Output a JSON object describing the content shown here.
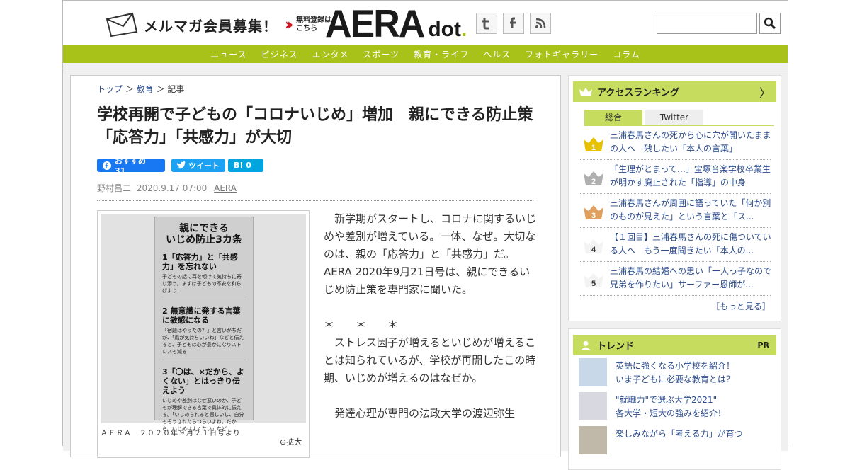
{
  "header": {
    "mailmag": "メルマガ会員募集！",
    "free_line1": "無料登録は",
    "free_line2": "こちら",
    "logo_main": "AERA",
    "logo_dot": "dot",
    "logo_period": ".",
    "social": [
      {
        "name": "twitter-icon",
        "glyph": "t"
      },
      {
        "name": "facebook-icon",
        "glyph": "f"
      },
      {
        "name": "rss-icon",
        "glyph": ")"
      }
    ],
    "search_placeholder": ""
  },
  "nav": [
    "ニュース",
    "ビジネス",
    "エンタメ",
    "スポーツ",
    "教育・ライフ",
    "ヘルス",
    "フォトギャラリー",
    "コラム"
  ],
  "breadcrumb": {
    "top": "トップ",
    "edu": "教育",
    "article": "記事"
  },
  "article": {
    "title": "学校再開で子どもの「コロナいじめ」増加　親にできる防止策「応答力」「共感力」が大切",
    "share_fb": "おすすめ 31",
    "share_tw": "ツイート",
    "share_hb": "B! 0",
    "author": "野村昌二",
    "date": "2020.9.17 07:00",
    "publication": "AERA",
    "image_caption": "ＡＥＲＡ　２０２０年９月２１日号より",
    "zoom": "拡大",
    "paragraphs": [
      "　新学期がスタートし、コロナに関するいじめや差別が増えている。一体、なぜ。大切なのは、親の「応答力」と「共感力」だ。AERA 2020年9月21日号は、親にできるいじめ防止策を専門家に聞いた。",
      "",
      "＊　　＊　　＊",
      "　ストレス因子が増えるといじめが増えることは知られているが、学校が再開したこの時期、いじめが増えるのはなぜか。",
      "",
      "　発達心理が専門の法政大学の渡辺弥生"
    ]
  },
  "card": {
    "heading1": "親にできる",
    "heading2": "いじめ防止3カ条",
    "items": [
      {
        "title": "1「応答力」と「共感力」を忘れない",
        "sub": "子どもの話に耳を傾けて気持ちに寄り添う。まずは子どもの不安を和らげよう"
      },
      {
        "title": "2 無意識に発する言葉に敏感になる",
        "sub": "「宿題はやったの？」と言いがちだが、「風が気持ちいいね」などと伝えると、子どもは心が豊かになりストレスも減る"
      },
      {
        "title": "3「〇は、×だから、よくない」とはっきり伝えよう",
        "sub": "いじめや差別はなぜ悪いのか、子どもが理解できる言葉で具体的に伝える。「いじめられると悲しいし、自分もそうされたらつらいよね。だから、いじめはよくない」など"
      }
    ]
  },
  "ranking": {
    "title": "アクセスランキング",
    "tab_all": "総合",
    "tab_twitter": "Twitter",
    "items": [
      {
        "rank": "1",
        "text": "三浦春馬さんの死から心に穴が開いたままの人へ　残したい「本人の言葉」"
      },
      {
        "rank": "2",
        "text": "「生理がとまって…」宝塚音楽学校卒業生が明かす廃止された「指導」の中身"
      },
      {
        "rank": "3",
        "text": "三浦春馬さんが周囲に語っていた「何か別のものが見えた」という言葉と「ス..."
      },
      {
        "rank": "4",
        "text": "【１回目】三浦春馬さんの死に傷ついている人へ　もう一度聞きたい「本人の..."
      },
      {
        "rank": "5",
        "text": "三浦春馬の結婚への思い「一人っ子なので兄弟を作りたい」サーファー恩師が..."
      }
    ],
    "more": "［もっと見る］"
  },
  "trend": {
    "title": "トレンド",
    "pr": "PR",
    "items": [
      {
        "line1": "英語に強くなる小学校を紹介！",
        "line2": "いま子どもに必要な教育とは？"
      },
      {
        "line1": "\"就職力\"で選ぶ大学2021\"",
        "line2": "各大学・短大の強みを紹介！"
      },
      {
        "line1": "楽しみながら「考える力」が育つ",
        "line2": ""
      }
    ]
  },
  "colors": {
    "brand_green": "#a8c21a",
    "panel_green": "#c5dc5e",
    "fb_blue": "#1877f2",
    "tw_blue": "#1da1f2",
    "hb_blue": "#00a4de",
    "link_blue": "#2a4a8a",
    "gold": "#e6c200",
    "silver": "#b0b0b0",
    "bronze": "#e0a060"
  }
}
